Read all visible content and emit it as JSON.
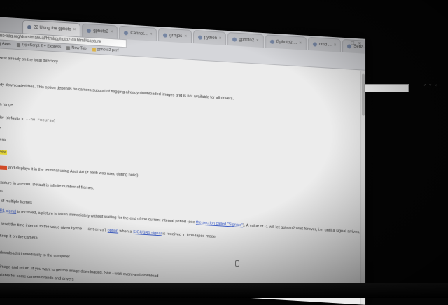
{
  "browser": {
    "tabs": [
      {
        "label": "22 Using the gphoto"
      },
      {
        "label": "gphoto2"
      },
      {
        "label": "Cannot..."
      },
      {
        "label": "grmjos"
      },
      {
        "label": "python"
      },
      {
        "label": "gphoto2"
      },
      {
        "label": "Gphoto2 ..."
      },
      {
        "label": "cmd ..."
      },
      {
        "label": "Seria..."
      },
      {
        "label": "Q"
      }
    ],
    "url": "hb4idg.org/docs/manual/html/gphoto2-cli.html#capture",
    "bookmarks": [
      {
        "label": "Apps"
      },
      {
        "label": "TypeScript 2 + Express"
      },
      {
        "label": "New Tab"
      },
      {
        "label": "gphoto2 perf"
      }
    ],
    "window_controls": [
      "–",
      "□",
      "×"
    ],
    "search_buttons": [
      "˄",
      "˅",
      "×"
    ]
  },
  "doc": {
    "lines": [
      {
        "parts": [
          {
            "t": "ry exist already on the local directory"
          }
        ]
      },
      {
        "parts": [
          {
            "t": "ready downloaded files. This option depends on camera support of flagging already downloaded images and is not available for all drivers."
          }
        ]
      },
      {
        "parts": [
          {
            "t": "er"
          }
        ]
      },
      {
        "parts": [
          {
            "t": "m in range"
          }
        ]
      },
      {
        "parts": [
          {
            "t": "folder (defaults to "
          },
          {
            "t": "--no-recurse",
            "cls": "mono"
          },
          {
            "t": ")"
          }
        ]
      },
      {
        "parts": [
          {
            "t": "ove"
          }
        ]
      },
      {
        "parts": [
          {
            "t": "amera"
          }
        ]
      },
      {
        "parts": [
          {
            "t": "review",
            "cls": "hl-yellow"
          }
        ]
      },
      {
        "parts": [
          {
            "t": "review",
            "cls": "hl-orange"
          },
          {
            "t": " and displays it in the terminal using Ascii Art (if aalib was used during build)"
          }
        ]
      },
      {
        "parts": [
          {
            "t": " to capture in one run. Default is infinite number of frames."
          }
        ]
      },
      {
        "parts": [
          {
            "t": "rows"
          }
        ]
      },
      {
        "parts": [
          {
            "t": "ore of multiple frames"
          }
        ]
      },
      {
        "parts": [
          {
            "t": "USR1 signal",
            "cls": "link"
          },
          {
            "t": " is received, a picture is taken immediately without waiting for the end of the current interval period (see "
          },
          {
            "t": "the section called \"Signals\"",
            "cls": "link"
          },
          {
            "t": "). A value of -1 will let gphoto2 wait forever, i.e. until a signal arrives. See also "
          },
          {
            "t": "--wait-event",
            "cls": "link"
          }
        ]
      },
      {
        "parts": [
          {
            "t": "will reset the time interval to the value given by the "
          },
          {
            "t": "--interval",
            "cls": "mono"
          },
          {
            "t": " "
          },
          {
            "t": "option",
            "cls": "link"
          },
          {
            "t": " when a "
          },
          {
            "t": "SIGUSR1 signal",
            "cls": "link"
          },
          {
            "t": " is received in time-lapse mode"
          }
        ]
      },
      {
        "parts": [
          {
            "t": "nd keep it on the camera"
          }
        ]
      },
      {
        "parts": [
          {
            "t": "ion"
          }
        ]
      },
      {
        "parts": [
          {
            "t": "nd download it immediately to the computer"
          }
        ]
      },
      {
        "parts": [
          {
            "t": "an image and return. If you want to get the image downloaded. See --wait-event-and-download"
          }
        ]
      },
      {
        "parts": [
          {
            "t": "available for some camera brands and drivers"
          }
        ]
      }
    ]
  }
}
